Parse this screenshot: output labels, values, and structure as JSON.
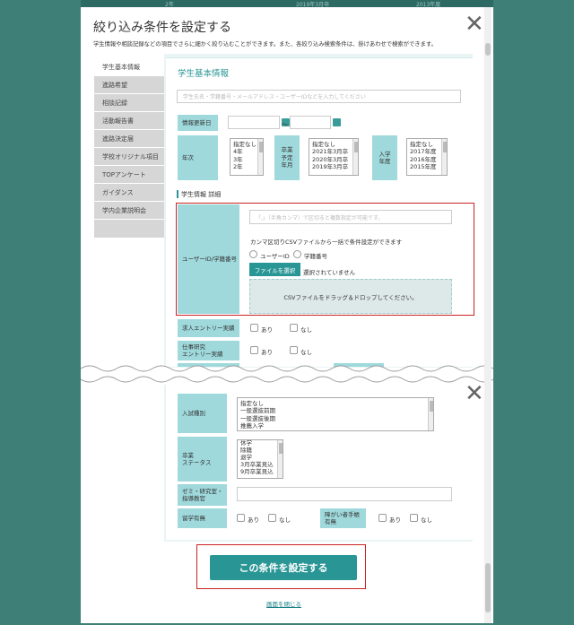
{
  "background_strip": [
    "2年",
    "2019年3月卒",
    "2013年度"
  ],
  "modal": {
    "title": "絞り込み条件を設定する",
    "description": "学生情報や相談記録などの項目でさらに細かく絞り込むことができます。また、各絞り込み検索条件は、掛けあわせで検索ができます。"
  },
  "sidebar": {
    "items": [
      {
        "label": "学生基本情報"
      },
      {
        "label": "進路希望"
      },
      {
        "label": "相談記録"
      },
      {
        "label": "活動報告書"
      },
      {
        "label": "進路決定届"
      },
      {
        "label": "学校オリジナル項目"
      },
      {
        "label": "TOPアンケート"
      },
      {
        "label": "ガイダンス"
      },
      {
        "label": "学内企業説明会"
      }
    ]
  },
  "section": {
    "title": "学生基本情報",
    "search_placeholder": "学生氏名・学籍番号・メールアドレス・ユーザーIDなどを入力してください",
    "update_date_label": "情報更新日",
    "date_separator": "〜",
    "grade_label": "年次",
    "grade_options": [
      "指定なし",
      "4年",
      "3年",
      "2年"
    ],
    "grad_label": "卒業予定年月",
    "grad_label_lines": [
      "卒業",
      "予定",
      "年月"
    ],
    "grad_options": [
      "指定なし",
      "2021年3月卒",
      "2020年3月卒",
      "2019年3月卒"
    ],
    "admission_label": "入学年度",
    "admission_label_lines": [
      "入学",
      "年度"
    ],
    "admission_options": [
      "指定なし",
      "2017年度",
      "2016年度",
      "2015年度"
    ]
  },
  "detail": {
    "title": "学生情報 詳細",
    "userid_label": "ユーザーID/学籍番号",
    "userid_placeholder": "「,」（半角カンマ）で区切ると複数指定が可能です。",
    "csv_note": "カンマ区切りCSVファイルから一括で条件設定ができます",
    "radio_userid": "ユーザーID",
    "radio_student_no": "学籍番号",
    "file_button": "ファイルを選択",
    "file_status": "選択されていません",
    "drop_text": "CSVファイルをドラッグ＆ドロップしてください。",
    "job_entry_label": "求人エントリー実績",
    "job_research_label": "仕事研究エントリー実績",
    "job_research_lines": [
      "仕事研究",
      "エントリー実績"
    ],
    "yes": "あり",
    "no": "なし"
  },
  "lower": {
    "entrance_label": "入試種別",
    "entrance_options": [
      "指定なし",
      "一般選抜前期",
      "一般選抜後期",
      "推薦入学"
    ],
    "status_label": "卒業ステータス",
    "status_label_lines": [
      "卒業",
      "ステータス"
    ],
    "status_options": [
      "休学",
      "除籍",
      "退学",
      "3月卒業見込",
      "9月卒業見込"
    ],
    "seminar_label": "ゼミ・研究室・指導教官",
    "seminar_label_lines": [
      "ゼミ・研究室・",
      "指導教官"
    ],
    "study_abroad_label": "留学有無",
    "disability_label": "障がい者手帳有無",
    "disability_label_lines": [
      "障がい者手帳",
      "有無"
    ],
    "yes": "あり",
    "no": "なし"
  },
  "footer": {
    "submit_label": "この条件を設定する",
    "close_link": "画面を閉じる"
  },
  "colors": {
    "accent": "#2a9595",
    "label_bg": "#9fd9dc",
    "highlight": "#cc2222",
    "overlay": "#3e7f78"
  }
}
